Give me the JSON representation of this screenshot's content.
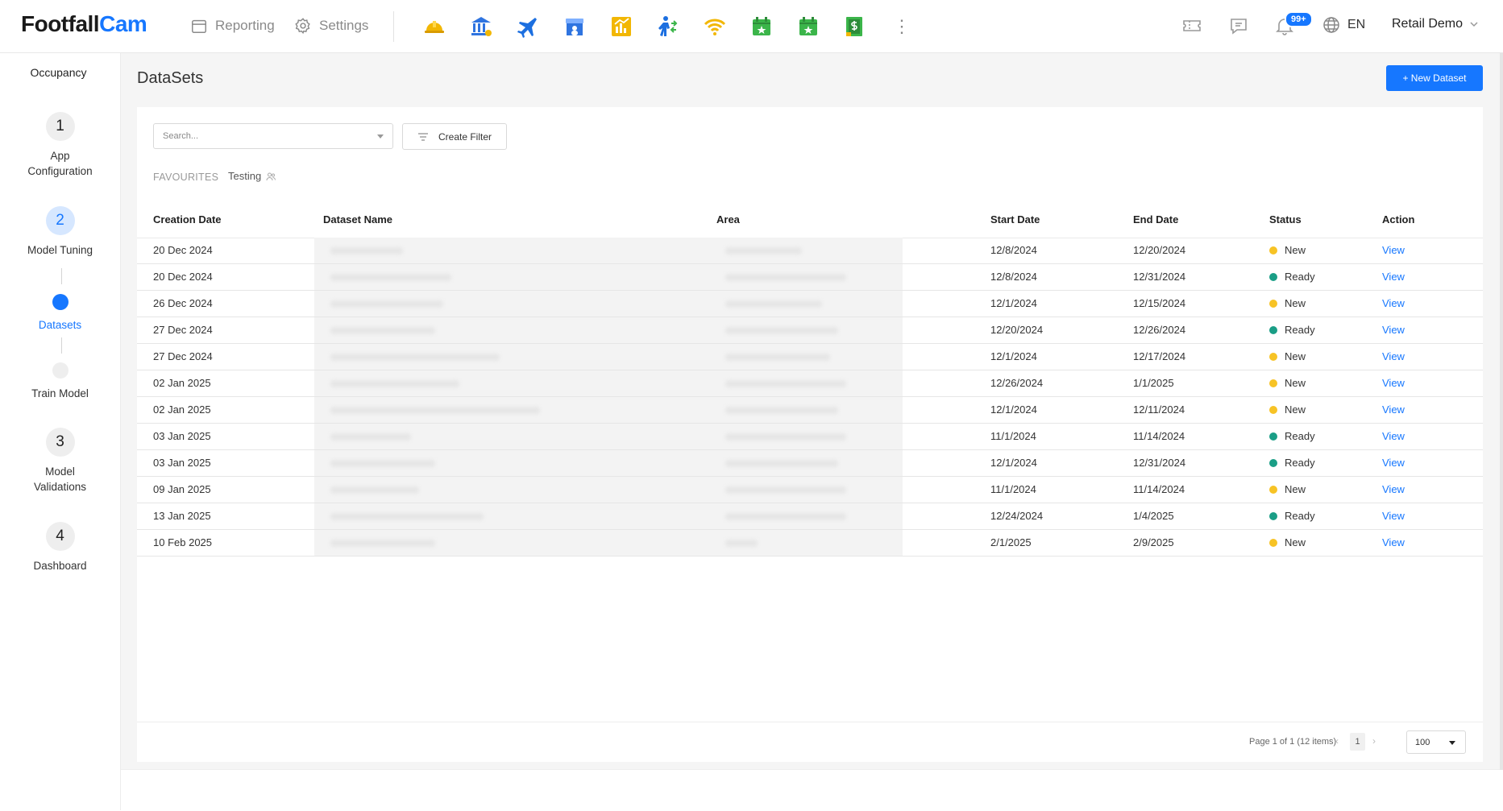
{
  "header": {
    "logo_part1": "Footfall",
    "logo_part2": "Cam",
    "nav_reporting": "Reporting",
    "nav_settings": "Settings",
    "notification_badge": "99+",
    "language": "EN",
    "user_name": "Retail Demo",
    "app_icons": [
      {
        "name": "hardhat-icon",
        "color": "#f2b705"
      },
      {
        "name": "bank-icon",
        "color": "#2f74e0"
      },
      {
        "name": "airplane-icon",
        "color": "#1c6fe0"
      },
      {
        "name": "store-icon",
        "color": "#2f74e0"
      },
      {
        "name": "analytics-chart-icon",
        "color": "#f2b705"
      },
      {
        "name": "people-flow-icon",
        "color": "#1c6fe0"
      },
      {
        "name": "wifi-icon",
        "color": "#f2b705"
      },
      {
        "name": "calendar-star-icon",
        "color": "#3bb54a"
      },
      {
        "name": "calendar-star-icon",
        "color": "#3bb54a"
      },
      {
        "name": "dollar-ticket-icon",
        "color": "#3bb54a"
      }
    ]
  },
  "sidebar": {
    "title": "Occupancy",
    "steps": [
      {
        "number": "1",
        "label_line1": "App",
        "label_line2": "Configuration"
      },
      {
        "number": "2",
        "label_line1": "Model Tuning"
      },
      {
        "label_line1": "Datasets"
      },
      {
        "label_line1": "Train Model"
      },
      {
        "number": "3",
        "label_line1": "Model",
        "label_line2": "Validations"
      },
      {
        "number": "4",
        "label_line1": "Dashboard"
      }
    ]
  },
  "main": {
    "title": "DataSets",
    "new_button": "+ New Dataset",
    "search_placeholder": "Search...",
    "filter_button": "Create Filter",
    "favourites_label": "FAVOURITES",
    "favourite_item": "Testing",
    "columns": [
      "Creation Date",
      "Dataset Name",
      "Area",
      "Start Date",
      "End Date",
      "Status",
      "Action"
    ],
    "rows": [
      {
        "created": "20 Dec 2024",
        "start": "12/8/2024",
        "end": "12/20/2024",
        "status": "New",
        "action": "View"
      },
      {
        "created": "20 Dec 2024",
        "start": "12/8/2024",
        "end": "12/31/2024",
        "status": "Ready",
        "action": "View"
      },
      {
        "created": "26 Dec 2024",
        "start": "12/1/2024",
        "end": "12/15/2024",
        "status": "New",
        "action": "View"
      },
      {
        "created": "27 Dec 2024",
        "start": "12/20/2024",
        "end": "12/26/2024",
        "status": "Ready",
        "action": "View"
      },
      {
        "created": "27 Dec 2024",
        "start": "12/1/2024",
        "end": "12/17/2024",
        "status": "New",
        "action": "View"
      },
      {
        "created": "02 Jan 2025",
        "start": "12/26/2024",
        "end": "1/1/2025",
        "status": "New",
        "action": "View"
      },
      {
        "created": "02 Jan 2025",
        "start": "12/1/2024",
        "end": "12/11/2024",
        "status": "New",
        "action": "View"
      },
      {
        "created": "03 Jan 2025",
        "start": "11/1/2024",
        "end": "11/14/2024",
        "status": "Ready",
        "action": "View"
      },
      {
        "created": "03 Jan 2025",
        "start": "12/1/2024",
        "end": "12/31/2024",
        "status": "Ready",
        "action": "View"
      },
      {
        "created": "09 Jan 2025",
        "start": "11/1/2024",
        "end": "11/14/2024",
        "status": "New",
        "action": "View"
      },
      {
        "created": "13 Jan 2025",
        "start": "12/24/2024",
        "end": "1/4/2025",
        "status": "Ready",
        "action": "View"
      },
      {
        "created": "10 Feb 2025",
        "start": "2/1/2025",
        "end": "2/9/2025",
        "status": "New",
        "action": "View"
      }
    ],
    "status_colors": {
      "New": "#f7c325",
      "Ready": "#1a9e86"
    },
    "pagination": {
      "info": "Page 1 of 1 (12 items)",
      "current_page": "1",
      "page_size": "100"
    }
  },
  "colors": {
    "accent": "#1677ff",
    "background": "#f5f5f5"
  }
}
